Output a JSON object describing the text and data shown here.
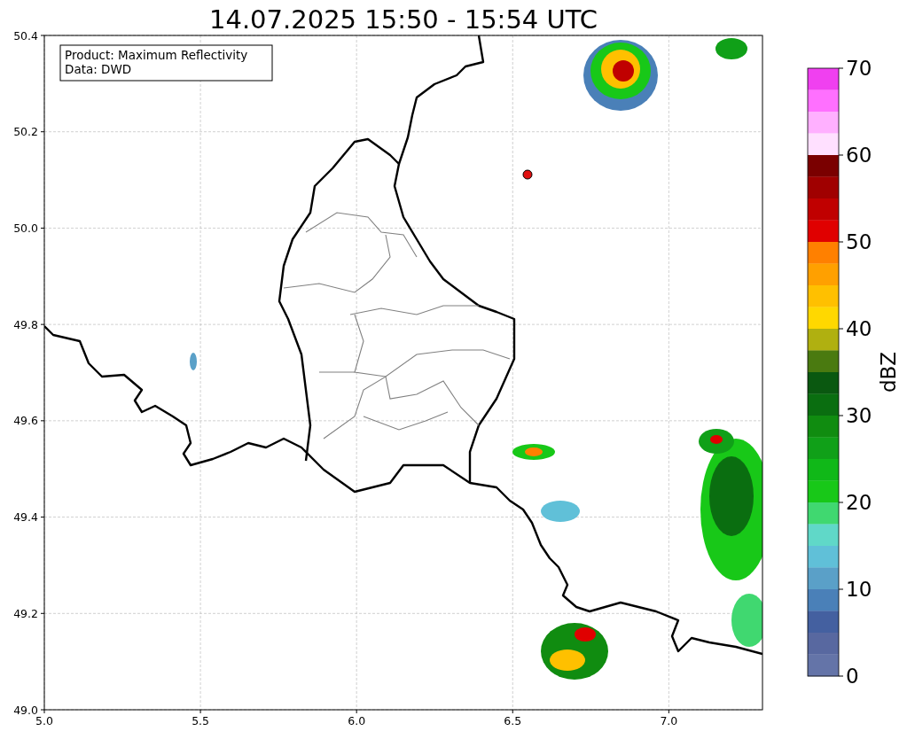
{
  "title": "14.07.2025 15:50 - 15:54 UTC",
  "info_box": [
    "Product: Maximum Reflectivity",
    "Data: DWD"
  ],
  "map": {
    "xticks": [
      "5.0",
      "5.5",
      "6.0",
      "6.5",
      "7.0"
    ],
    "yticks": [
      "50.4",
      "50.2",
      "50.0",
      "49.8",
      "49.6",
      "49.4",
      "49.2",
      "49.0"
    ]
  },
  "colorbar": {
    "label": "dBZ",
    "ticks": [
      "70",
      "60",
      "50",
      "40",
      "30",
      "20",
      "10",
      "0"
    ],
    "bands": [
      {
        "color": "#f040f0"
      },
      {
        "color": "#ff70ff"
      },
      {
        "color": "#ffb0ff"
      },
      {
        "color": "#ffe0ff"
      },
      {
        "color": "#7a0000"
      },
      {
        "color": "#a00000"
      },
      {
        "color": "#c00000"
      },
      {
        "color": "#e00000"
      },
      {
        "color": "#ff8000"
      },
      {
        "color": "#ffa000"
      },
      {
        "color": "#ffc000"
      },
      {
        "color": "#ffd800"
      },
      {
        "color": "#b0b010"
      },
      {
        "color": "#4a7a10"
      },
      {
        "color": "#0a5810"
      },
      {
        "color": "#0a6e10"
      },
      {
        "color": "#108c10"
      },
      {
        "color": "#10a018"
      },
      {
        "color": "#10b818"
      },
      {
        "color": "#18c818"
      },
      {
        "color": "#40d870"
      },
      {
        "color": "#60d8c8"
      },
      {
        "color": "#60c0d8"
      },
      {
        "color": "#5aa0c8"
      },
      {
        "color": "#4a80b8"
      },
      {
        "color": "#4460a0"
      },
      {
        "color": "#5868a0"
      },
      {
        "color": "#6474a8"
      }
    ]
  }
}
